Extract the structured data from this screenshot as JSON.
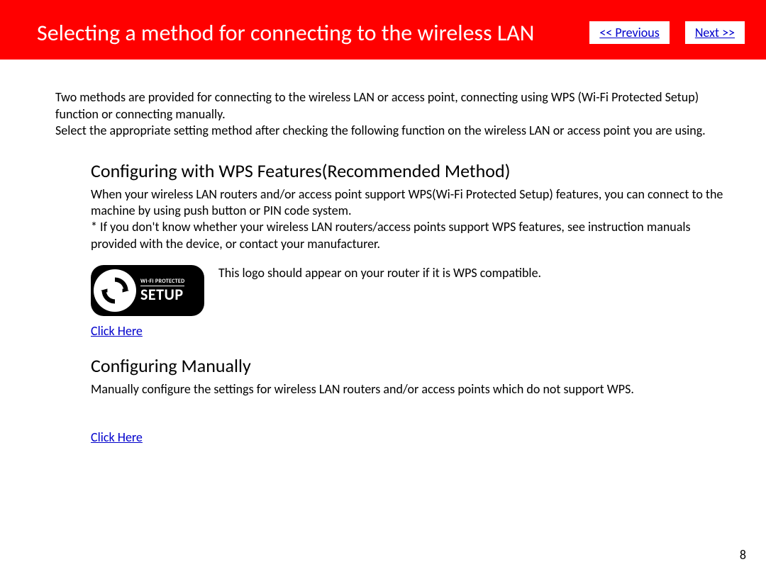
{
  "header": {
    "title": "Selecting a method for connecting to the wireless LAN",
    "prev_label": "<< Previous",
    "next_label": "Next >>"
  },
  "intro": "Two methods are provided for connecting to the wireless LAN or access point, connecting using WPS (Wi-Fi Protected Setup) function or connecting manually.\nSelect the appropriate setting method after checking the following function on the wireless LAN or access point you are using.",
  "wps": {
    "heading": "Configuring with WPS Features(Recommended Method)",
    "body": "When your wireless LAN routers and/or access point support WPS(Wi-Fi Protected Setup) features, you can connect to the machine by using push button or PIN code system.\n* If you don't know whether your wireless LAN routers/access points support WPS features, see instruction manuals provided with the device, or contact your manufacturer.",
    "logo_top": "Wi-Fi PROTECTED",
    "logo_bot": "SETUP",
    "logo_caption": "This logo should appear on your router if it is WPS compatible.",
    "link": "Click Here"
  },
  "manual": {
    "heading": "Configuring Manually",
    "body": "Manually configure the settings for wireless LAN routers and/or access points which do not support WPS.",
    "link": "Click Here"
  },
  "page_number": "8"
}
